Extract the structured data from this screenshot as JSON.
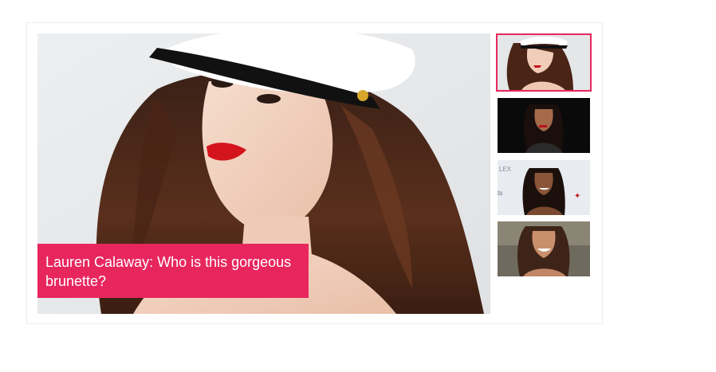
{
  "slider": {
    "caption": "Lauren Calaway: Who is this gorgeous brunette?",
    "accent_color": "#e8265e",
    "main_image": "photo-brunette-captain-hat",
    "thumbnails": [
      {
        "image": "photo-brunette-captain-hat",
        "active": true
      },
      {
        "image": "photo-woman-dark-outfit",
        "active": false
      },
      {
        "image": "photo-woman-smiling-event",
        "active": false
      },
      {
        "image": "photo-woman-smiling-outdoors",
        "active": false
      }
    ]
  }
}
